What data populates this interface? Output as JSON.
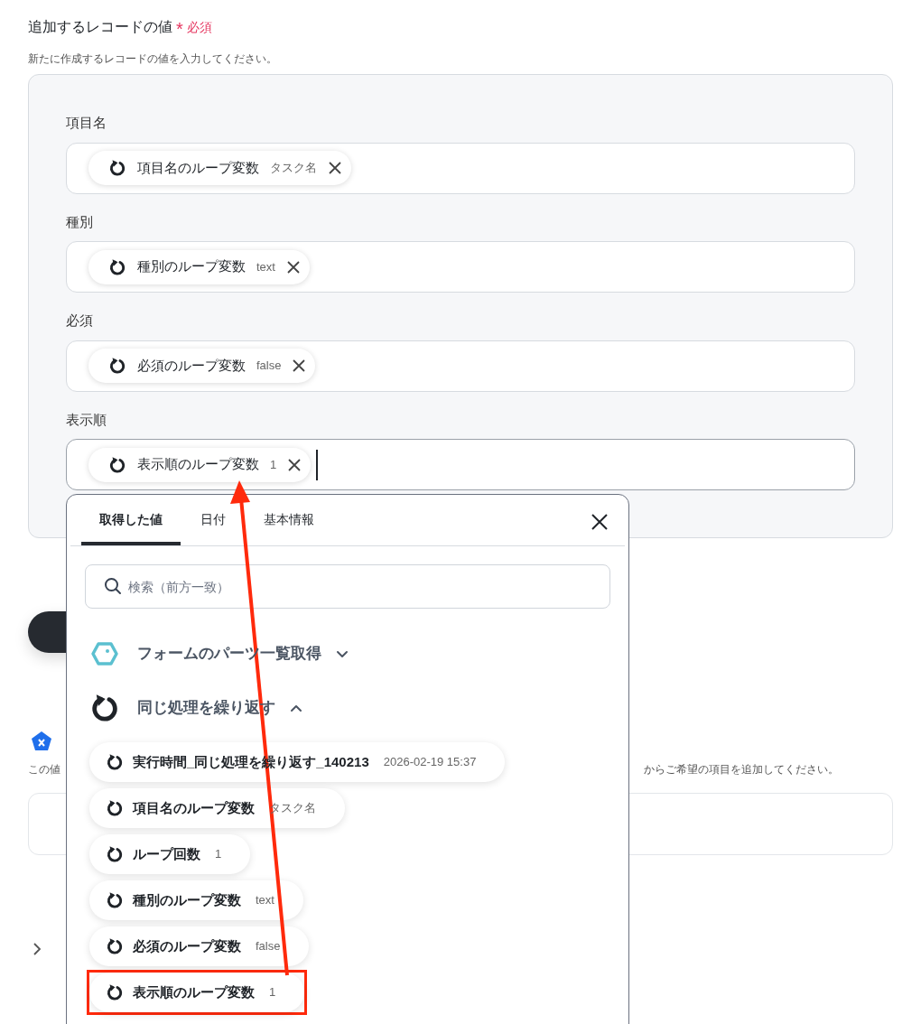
{
  "field": {
    "label": "追加するレコードの値",
    "required_mark": "*",
    "required_label": "必須",
    "help": "新たに作成するレコードの値を入力してください。"
  },
  "rows": [
    {
      "label": "項目名",
      "chip": {
        "name": "項目名のループ変数",
        "value": "タスク名"
      },
      "focused": false
    },
    {
      "label": "種別",
      "chip": {
        "name": "種別のループ変数",
        "value": "text"
      },
      "focused": false
    },
    {
      "label": "必須",
      "chip": {
        "name": "必須のループ変数",
        "value": "false"
      },
      "focused": false
    },
    {
      "label": "表示順",
      "chip": {
        "name": "表示順のループ変数",
        "value": "1"
      },
      "focused": true
    }
  ],
  "section": {
    "help_start": "この値",
    "help_end": "からご希望の項目を追加してください。"
  },
  "popup": {
    "tabs": [
      {
        "label": "取得した値",
        "selected": true
      },
      {
        "label": "日付",
        "selected": false
      },
      {
        "label": "基本情報",
        "selected": false
      }
    ],
    "search": {
      "placeholder": "検索（前方一致）"
    },
    "groups": [
      {
        "title": "フォームのパーツ一覧取得",
        "kind": "form",
        "expanded": false
      },
      {
        "title": "同じ処理を繰り返す",
        "kind": "loop",
        "expanded": true,
        "items": [
          {
            "name": "実行時間_同じ処理を繰り返す_140213",
            "value": "2026-02-19 15:37",
            "highlighted": false
          },
          {
            "name": "項目名のループ変数",
            "value": "タスク名",
            "highlighted": false
          },
          {
            "name": "ループ回数",
            "value": "1",
            "highlighted": false
          },
          {
            "name": "種別のループ変数",
            "value": "text",
            "highlighted": false
          },
          {
            "name": "必須のループ変数",
            "value": "false",
            "highlighted": false
          },
          {
            "name": "表示順のループ変数",
            "value": "1",
            "highlighted": true
          }
        ]
      }
    ]
  }
}
